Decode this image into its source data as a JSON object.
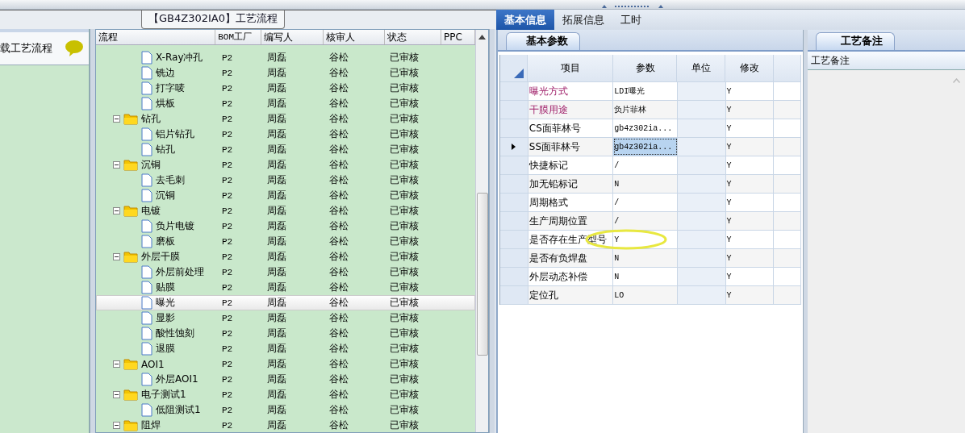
{
  "left_panel": {
    "title": "载工艺流程"
  },
  "flow_tab": {
    "title": "【GB4Z302IA0】工艺流程"
  },
  "tree": {
    "columns": [
      "流程",
      "BOM工厂",
      "编写人",
      "核审人",
      "状态",
      "PPC"
    ],
    "nodes": [
      {
        "kind": "leaf",
        "label": "X-Ray冲孔",
        "bom": "P2",
        "writer": "周磊",
        "reviewer": "谷松",
        "status": "已审核",
        "selected": false
      },
      {
        "kind": "leaf",
        "label": "铣边",
        "bom": "P2",
        "writer": "周磊",
        "reviewer": "谷松",
        "status": "已审核",
        "selected": false
      },
      {
        "kind": "leaf",
        "label": "打字唛",
        "bom": "P2",
        "writer": "周磊",
        "reviewer": "谷松",
        "status": "已审核",
        "selected": false
      },
      {
        "kind": "leaf",
        "label": "烘板",
        "bom": "P2",
        "writer": "周磊",
        "reviewer": "谷松",
        "status": "已审核",
        "selected": false
      },
      {
        "kind": "folder",
        "label": "钻孔",
        "bom": "P2",
        "writer": "周磊",
        "reviewer": "谷松",
        "status": "已审核",
        "selected": false,
        "expanded": true,
        "children": [
          {
            "kind": "leaf",
            "label": "铝片钻孔",
            "bom": "P2",
            "writer": "周磊",
            "reviewer": "谷松",
            "status": "已审核",
            "selected": false
          },
          {
            "kind": "leaf",
            "label": "钻孔",
            "bom": "P2",
            "writer": "周磊",
            "reviewer": "谷松",
            "status": "已审核",
            "selected": false
          }
        ]
      },
      {
        "kind": "folder",
        "label": "沉铜",
        "bom": "P2",
        "writer": "周磊",
        "reviewer": "谷松",
        "status": "已审核",
        "selected": false,
        "expanded": true,
        "children": [
          {
            "kind": "leaf",
            "label": "去毛刺",
            "bom": "P2",
            "writer": "周磊",
            "reviewer": "谷松",
            "status": "已审核",
            "selected": false
          },
          {
            "kind": "leaf",
            "label": "沉铜",
            "bom": "P2",
            "writer": "周磊",
            "reviewer": "谷松",
            "status": "已审核",
            "selected": false
          }
        ]
      },
      {
        "kind": "folder",
        "label": "电镀",
        "bom": "P2",
        "writer": "周磊",
        "reviewer": "谷松",
        "status": "已审核",
        "selected": false,
        "expanded": true,
        "children": [
          {
            "kind": "leaf",
            "label": "负片电镀",
            "bom": "P2",
            "writer": "周磊",
            "reviewer": "谷松",
            "status": "已审核",
            "selected": false
          },
          {
            "kind": "leaf",
            "label": "磨板",
            "bom": "P2",
            "writer": "周磊",
            "reviewer": "谷松",
            "status": "已审核",
            "selected": false
          }
        ]
      },
      {
        "kind": "folder",
        "label": "外层干膜",
        "bom": "P2",
        "writer": "周磊",
        "reviewer": "谷松",
        "status": "已审核",
        "selected": false,
        "expanded": true,
        "children": [
          {
            "kind": "leaf",
            "label": "外层前处理",
            "bom": "P2",
            "writer": "周磊",
            "reviewer": "谷松",
            "status": "已审核",
            "selected": false
          },
          {
            "kind": "leaf",
            "label": "贴膜",
            "bom": "P2",
            "writer": "周磊",
            "reviewer": "谷松",
            "status": "已审核",
            "selected": false
          },
          {
            "kind": "leaf",
            "label": "曝光",
            "bom": "P2",
            "writer": "周磊",
            "reviewer": "谷松",
            "status": "已审核",
            "selected": true
          },
          {
            "kind": "leaf",
            "label": "显影",
            "bom": "P2",
            "writer": "周磊",
            "reviewer": "谷松",
            "status": "已审核",
            "selected": false
          },
          {
            "kind": "leaf",
            "label": "酸性蚀刻",
            "bom": "P2",
            "writer": "周磊",
            "reviewer": "谷松",
            "status": "已审核",
            "selected": false
          },
          {
            "kind": "leaf",
            "label": "退膜",
            "bom": "P2",
            "writer": "周磊",
            "reviewer": "谷松",
            "status": "已审核",
            "selected": false
          }
        ]
      },
      {
        "kind": "folder",
        "label": "AOI1",
        "bom": "P2",
        "writer": "周磊",
        "reviewer": "谷松",
        "status": "已审核",
        "selected": false,
        "expanded": true,
        "children": [
          {
            "kind": "leaf",
            "label": "外层AOI1",
            "bom": "P2",
            "writer": "周磊",
            "reviewer": "谷松",
            "status": "已审核",
            "selected": false
          }
        ]
      },
      {
        "kind": "folder",
        "label": "电子测试1",
        "bom": "P2",
        "writer": "周磊",
        "reviewer": "谷松",
        "status": "已审核",
        "selected": false,
        "expanded": true,
        "children": [
          {
            "kind": "leaf",
            "label": "低阻测试1",
            "bom": "P2",
            "writer": "周磊",
            "reviewer": "谷松",
            "status": "已审核",
            "selected": false
          }
        ]
      },
      {
        "kind": "folder",
        "label": "阻焊",
        "bom": "P2",
        "writer": "周磊",
        "reviewer": "谷松",
        "status": "已审核",
        "selected": false,
        "expanded": true
      }
    ]
  },
  "tabs": [
    {
      "label": "基本信息",
      "selected": true
    },
    {
      "label": "拓展信息",
      "selected": false
    },
    {
      "label": "工时",
      "selected": false
    }
  ],
  "sub_tab": {
    "label": "基本参数"
  },
  "params": {
    "columns": [
      "项目",
      "参数",
      "单位",
      "修改"
    ],
    "rows": [
      {
        "item": "曝光方式",
        "value": "LDI曝光",
        "modify": "Y",
        "emphasized": true,
        "selected": false
      },
      {
        "item": "干膜用途",
        "value": "负片菲林",
        "modify": "Y",
        "emphasized": true,
        "selected": false
      },
      {
        "item": "CS面菲林号",
        "value": "gb4z302ia...",
        "modify": "Y",
        "emphasized": false,
        "selected": false
      },
      {
        "item": "SS面菲林号",
        "value": "gb4z302ia...",
        "modify": "Y",
        "emphasized": false,
        "selected": true
      },
      {
        "item": "快捷标记",
        "value": "/",
        "modify": "Y",
        "emphasized": false,
        "selected": false
      },
      {
        "item": "加无铅标记",
        "value": "N",
        "modify": "Y",
        "emphasized": false,
        "selected": false
      },
      {
        "item": "周期格式",
        "value": "/",
        "modify": "Y",
        "emphasized": false,
        "selected": false
      },
      {
        "item": "生产周期位置",
        "value": "/",
        "modify": "Y",
        "emphasized": false,
        "selected": false
      },
      {
        "item": "是否存在生产型号",
        "value": "Y",
        "modify": "Y",
        "emphasized": false,
        "selected": false,
        "circled": true
      },
      {
        "item": "是否有负焊盘",
        "value": "N",
        "modify": "Y",
        "emphasized": false,
        "selected": false
      },
      {
        "item": "外层动态补偿",
        "value": "N",
        "modify": "Y",
        "emphasized": false,
        "selected": false
      },
      {
        "item": "定位孔",
        "value": "LO",
        "modify": "Y",
        "emphasized": false,
        "selected": false
      }
    ]
  },
  "remarks": {
    "tab": "工艺备注",
    "header": "工艺备注"
  }
}
